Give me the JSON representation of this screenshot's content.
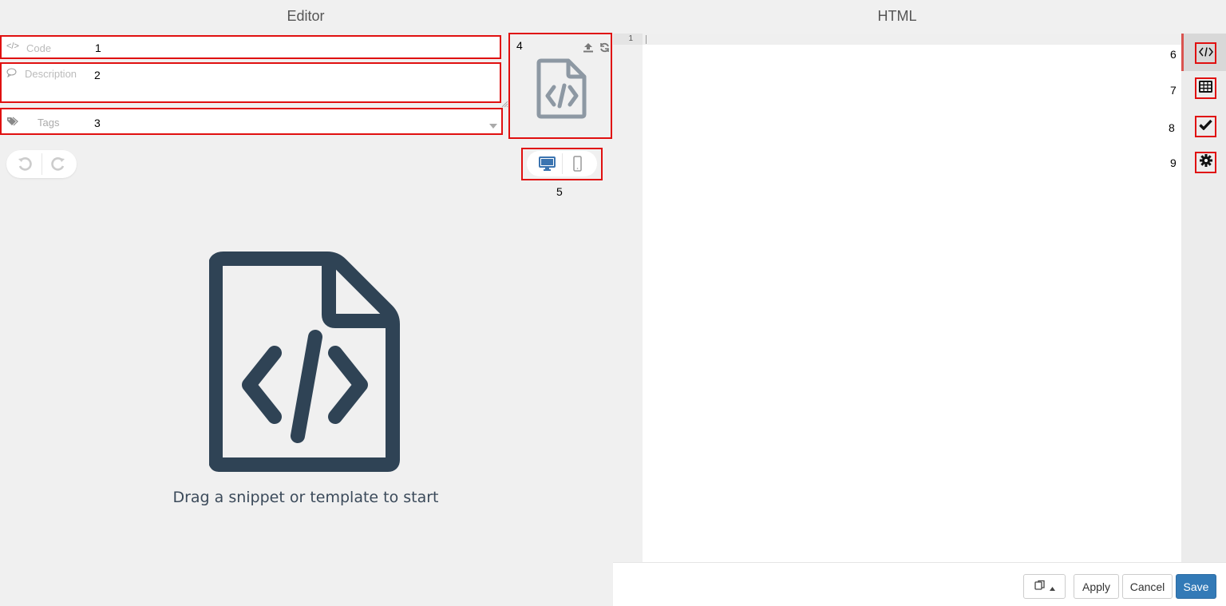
{
  "editor": {
    "title": "Editor",
    "code_placeholder": "Code",
    "description_placeholder": "Description",
    "tags_placeholder": "Tags",
    "empty_message": "Drag a snippet or template to start"
  },
  "code_panel": {
    "title": "HTML",
    "line_numbers": [
      "1"
    ]
  },
  "annotations": {
    "code": "1",
    "description": "2",
    "tags": "3",
    "thumbnail": "4",
    "device": "5",
    "side_code": "6",
    "side_grid": "7",
    "side_check": "8",
    "side_settings": "9"
  },
  "footer": {
    "apply": "Apply",
    "cancel": "Cancel",
    "save": "Save"
  },
  "colors": {
    "accent_blue": "#337ab7",
    "annotation_red": "#e01010",
    "active_tab_marker": "#d9534f",
    "icon_dark": "#2f4355"
  }
}
